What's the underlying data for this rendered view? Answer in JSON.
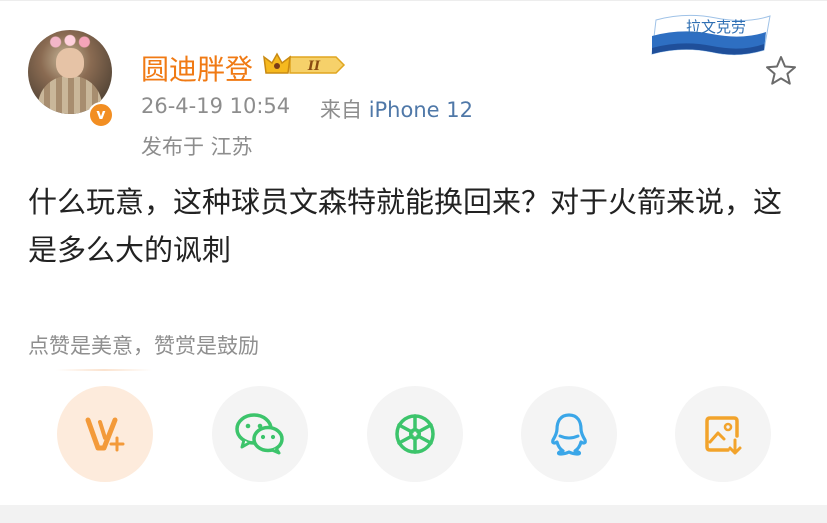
{
  "post": {
    "user": {
      "name": "圆迪胖登",
      "rank_level": "II"
    },
    "time": "26-4-19 10:54",
    "source_prefix": "来自",
    "device": "iPhone 12",
    "location": "发布于 江苏",
    "content": "什么玩意，这种球员文森特就能换回来？对于火箭来说，这是多么大的讽刺",
    "ribbon_text": "拉文克劳"
  },
  "reward": {
    "hint": "点赞是美意，赞赏是鼓励"
  },
  "share_buttons": [
    {
      "icon": "reward-v-icon"
    },
    {
      "icon": "wechat-icon"
    },
    {
      "icon": "moments-icon"
    },
    {
      "icon": "qq-icon"
    },
    {
      "icon": "save-image-icon"
    }
  ],
  "colors": {
    "username": "#f07a14",
    "device": "#4f78a8",
    "meta": "#8d8d8d",
    "verified": "#f28e22",
    "wechat": "#3cc46b",
    "qq": "#3aa6e8",
    "save": "#f2a32b"
  }
}
